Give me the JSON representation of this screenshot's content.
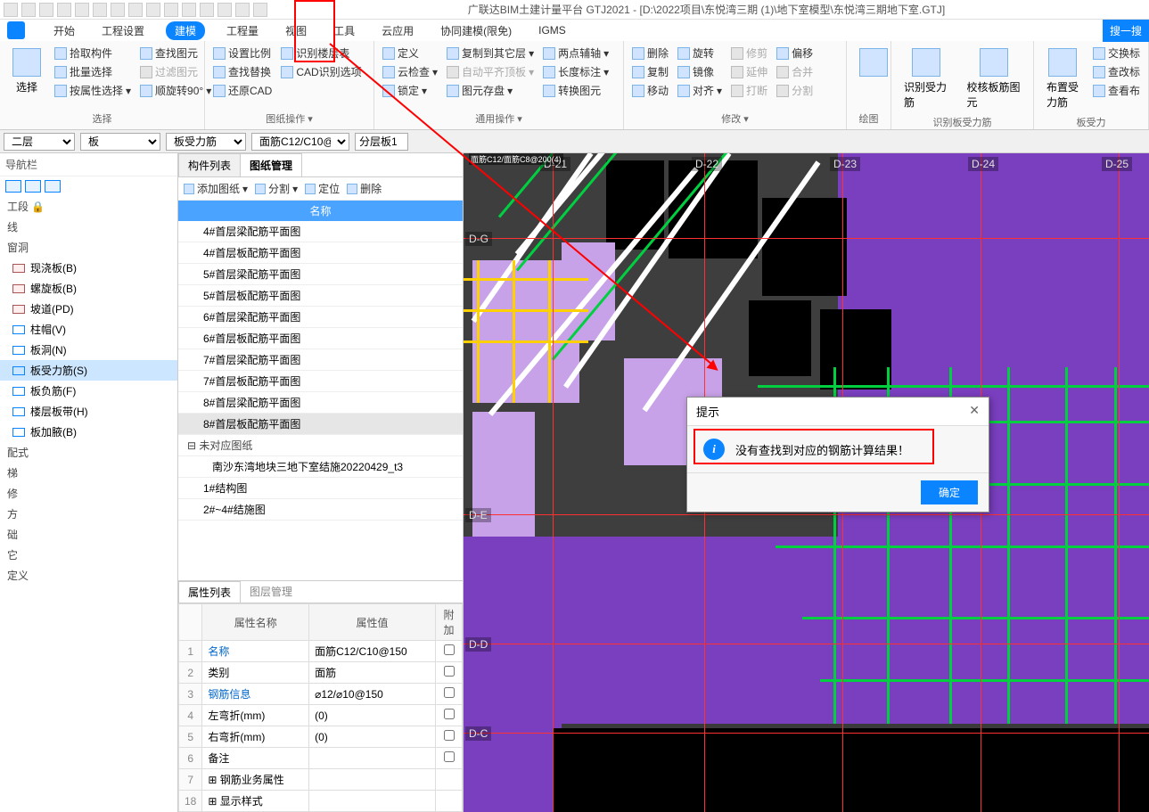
{
  "title": "广联达BIM土建计量平台 GTJ2021 - [D:\\2022项目\\东悦湾三期 (1)\\地下室模型\\东悦湾三期地下室.GTJ]",
  "menu": {
    "items": [
      "开始",
      "工程设置",
      "建模",
      "工程量",
      "视图",
      "工具",
      "云应用",
      "协同建模(限免)",
      "IGMS"
    ],
    "activeIndex": 2
  },
  "searchBtn": "搜一搜",
  "ribbon": {
    "select": {
      "big": "选择",
      "items": [
        "拾取构件",
        "批量选择",
        "按属性选择"
      ],
      "items2": [
        "查找图元",
        "过滤图元",
        "顺旋转90°"
      ],
      "label": "选择"
    },
    "cad": {
      "items": [
        "设置比例",
        "查找替换",
        "还原CAD"
      ],
      "items2": [
        "识别楼层表",
        "CAD识别选项"
      ],
      "label": "图纸操作"
    },
    "common": {
      "items": [
        "定义",
        "云检查",
        "锁定"
      ],
      "items2": [
        "复制到其它层",
        "自动平齐顶板",
        "图元存盘"
      ],
      "items3": [
        "两点辅轴",
        "长度标注",
        "转换图元"
      ],
      "label": "通用操作"
    },
    "modify": {
      "items": [
        "删除",
        "复制",
        "移动"
      ],
      "items2": [
        "旋转",
        "镜像",
        "对齐"
      ],
      "items3": [
        "修剪",
        "延伸",
        "打断"
      ],
      "items4": [
        "偏移",
        "合并",
        "分割"
      ],
      "label": "修改"
    },
    "draw": {
      "label": "绘图"
    },
    "recognize": {
      "big1": "识别受力筋",
      "big2": "校核板筋图元",
      "label": "识别板受力筋"
    },
    "layout": {
      "big": "布置受力筋",
      "items": [
        "交换标",
        "查改标",
        "查看布"
      ],
      "label": "板受力"
    }
  },
  "contextBar": {
    "floor": "二层",
    "cat": "板",
    "type": "板受力筋",
    "name": "面筋C12/C10@",
    "layer": "分层板1"
  },
  "nav": {
    "title": "导航栏",
    "groups": [
      "工段",
      "线",
      "窗洞"
    ],
    "leaves": [
      "现浇板(B)",
      "螺旋板(B)",
      "坡道(PD)",
      "柱帽(V)",
      "板洞(N)",
      "板受力筋(S)",
      "板负筋(F)",
      "楼层板带(H)",
      "板加腋(B)"
    ],
    "activeIndex": 5,
    "tail": [
      "配式",
      "梯",
      "修",
      "方",
      "础",
      "它",
      "定义"
    ]
  },
  "midTabs": {
    "tab1": "构件列表",
    "tab2": "图纸管理",
    "active": 1
  },
  "midToolbar": {
    "add": "添加图纸",
    "split": "分割",
    "locate": "定位",
    "del": "删除"
  },
  "nameHeader": "名称",
  "dwgList": [
    "4#首层梁配筋平面图",
    "4#首层板配筋平面图",
    "5#首层梁配筋平面图",
    "5#首层板配筋平面图",
    "6#首层梁配筋平面图",
    "6#首层板配筋平面图",
    "7#首层梁配筋平面图",
    "7#首层板配筋平面图",
    "8#首层梁配筋平面图",
    "8#首层板配筋平面图"
  ],
  "dwgSelectedIndex": 9,
  "dwgGroup": "未对应图纸",
  "dwgExtra": [
    "南沙东湾地块三地下室结施20220429_t3",
    "1#结构图",
    "2#~4#结施图"
  ],
  "propTabs": {
    "tab1": "属性列表",
    "tab2": "图层管理",
    "active": 0
  },
  "propHeaders": {
    "name": "属性名称",
    "value": "属性值",
    "extra": "附加"
  },
  "props": [
    {
      "n": "1",
      "name": "名称",
      "value": "面筋C12/C10@150",
      "link": true
    },
    {
      "n": "2",
      "name": "类别",
      "value": "面筋"
    },
    {
      "n": "3",
      "name": "钢筋信息",
      "value": "⌀12/⌀10@150",
      "link": true
    },
    {
      "n": "4",
      "name": "左弯折(mm)",
      "value": "(0)"
    },
    {
      "n": "5",
      "name": "右弯折(mm)",
      "value": "(0)"
    },
    {
      "n": "6",
      "name": "备注",
      "value": ""
    },
    {
      "n": "7",
      "name": "钢筋业务属性",
      "value": "",
      "expand": true
    },
    {
      "n": "18",
      "name": "显示样式",
      "value": "",
      "expand": true
    }
  ],
  "gridLabels": [
    "D-21",
    "D-22",
    "D-23",
    "D-24",
    "D-25"
  ],
  "gridRowLabels": [
    "D-G",
    "D-E",
    "D-D",
    "D-C"
  ],
  "overlayText": "面筋C12/面筋C8@200(4)",
  "dialog": {
    "title": "提示",
    "message": "没有查找到对应的钢筋计算结果！",
    "ok": "确定"
  }
}
